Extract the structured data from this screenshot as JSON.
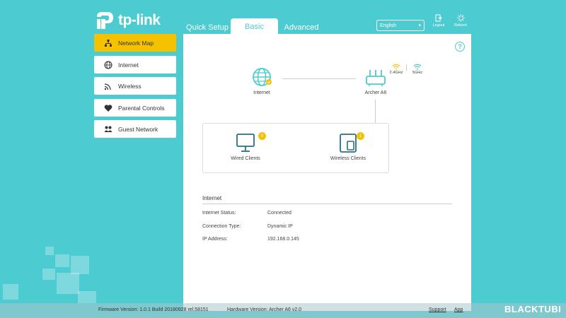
{
  "brand": {
    "logo_text": "tp-link"
  },
  "tabs": [
    {
      "label": "Quick Setup"
    },
    {
      "label": "Basic",
      "active": true
    },
    {
      "label": "Advanced"
    }
  ],
  "language": {
    "selected": "English"
  },
  "top_actions": {
    "logout": "Logout",
    "reboot": "Reboot"
  },
  "sidebar": {
    "items": [
      {
        "label": "Network Map",
        "icon": "network-map-icon",
        "active": true
      },
      {
        "label": "Internet",
        "icon": "globe-icon"
      },
      {
        "label": "Wireless",
        "icon": "wireless-icon"
      },
      {
        "label": "Parental Controls",
        "icon": "heart-icon"
      },
      {
        "label": "Guest Network",
        "icon": "guest-icon"
      }
    ]
  },
  "network_map": {
    "internet_label": "Internet",
    "router_label": "Archer A6",
    "band_24": "2.4GHz",
    "band_5": "5GHz",
    "wired_clients": {
      "label": "Wired Clients",
      "count": "0"
    },
    "wireless_clients": {
      "label": "Wireless Clients",
      "count": "1"
    }
  },
  "internet_info": {
    "title": "Internet",
    "rows": [
      {
        "key": "Internet Status:",
        "value": "Connected"
      },
      {
        "key": "Connection Type:",
        "value": "Dynamic IP"
      },
      {
        "key": "IP Address:",
        "value": "192.168.0.145"
      }
    ]
  },
  "footer": {
    "firmware": "Firmware Version: 1.0.1 Build 20180928 rel.58151",
    "hardware": "Hardware Version: Archer A6 v2.0",
    "support": "Support",
    "app": "App"
  },
  "watermark": "BLACKTUBI",
  "colors": {
    "accent": "#4ccbd0",
    "active": "#f6c200",
    "badge": "#f6c200"
  }
}
